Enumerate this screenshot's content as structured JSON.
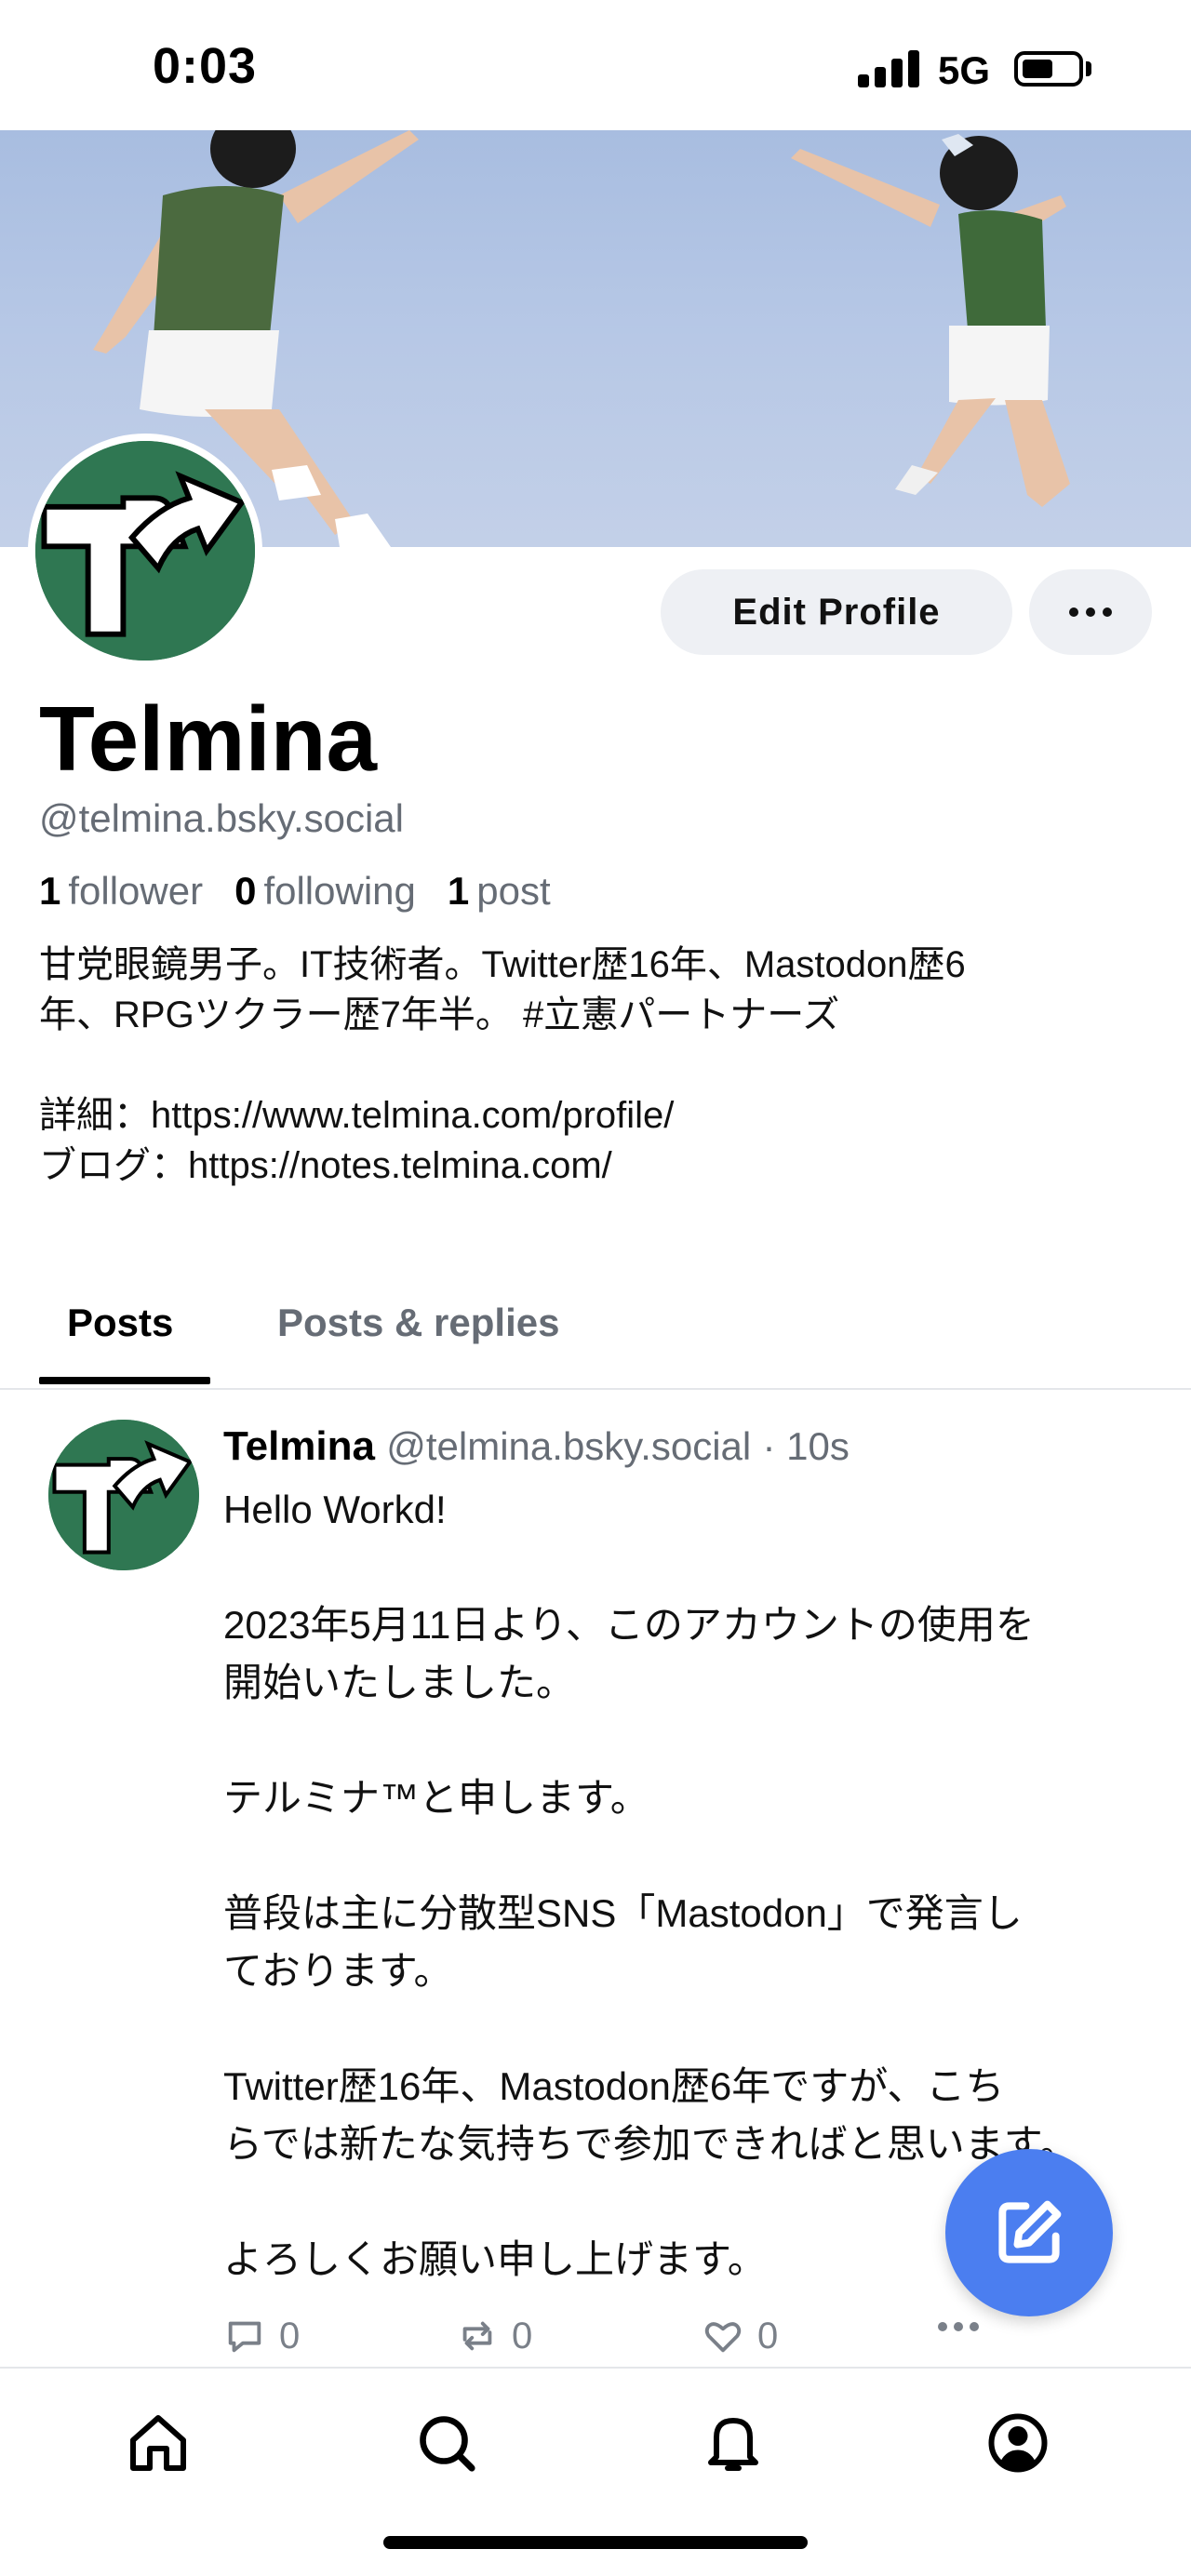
{
  "status_bar": {
    "time": "0:03",
    "network": "5G"
  },
  "profile": {
    "display_name": "Telmina",
    "handle": "@telmina.bsky.social",
    "edit_button_label": "Edit Profile",
    "stats": {
      "followers_count": "1",
      "followers_label": "follower",
      "following_count": "0",
      "following_label": "following",
      "posts_count": "1",
      "posts_label": "post"
    },
    "bio": "甘党眼鏡男子。IT技術者。Twitter歴16年、Mastodon歴6\n年、RPGツクラー歴7年半。 #立憲パートナーズ\n\n詳細：https://www.telmina.com/profile/\nブログ：https://notes.telmina.com/"
  },
  "tabs": [
    {
      "label": "Posts",
      "active": true
    },
    {
      "label": "Posts & replies",
      "active": false
    }
  ],
  "post": {
    "author": "Telmina",
    "handle": "@telmina.bsky.social",
    "time": "· 10s",
    "text": "Hello Workd!\n\n2023年5月11日より、このアカウントの使用を\n開始いたしました。\n\nテルミナ™と申します。\n\n普段は主に分散型SNS「Mastodon」で発言し\nております。\n\nTwitter歴16年、Mastodon歴6年ですが、こち\nらでは新たな気持ちで参加できればと思います。\n\nよろしくお願い申し上げます。",
    "reply_count": "0",
    "repost_count": "0",
    "like_count": "0"
  },
  "icons": {
    "reply": "reply-icon",
    "repost": "repost-icon",
    "like": "heart-icon",
    "more": "more-icon",
    "compose": "compose-icon",
    "home": "home-icon",
    "search": "search-icon",
    "notifications": "bell-icon",
    "profile": "profile-icon"
  },
  "colors": {
    "accent": "#4b7ef0",
    "avatar_green": "#2f7752",
    "muted_text": "#666c75",
    "button_bg": "#eef0f4"
  }
}
